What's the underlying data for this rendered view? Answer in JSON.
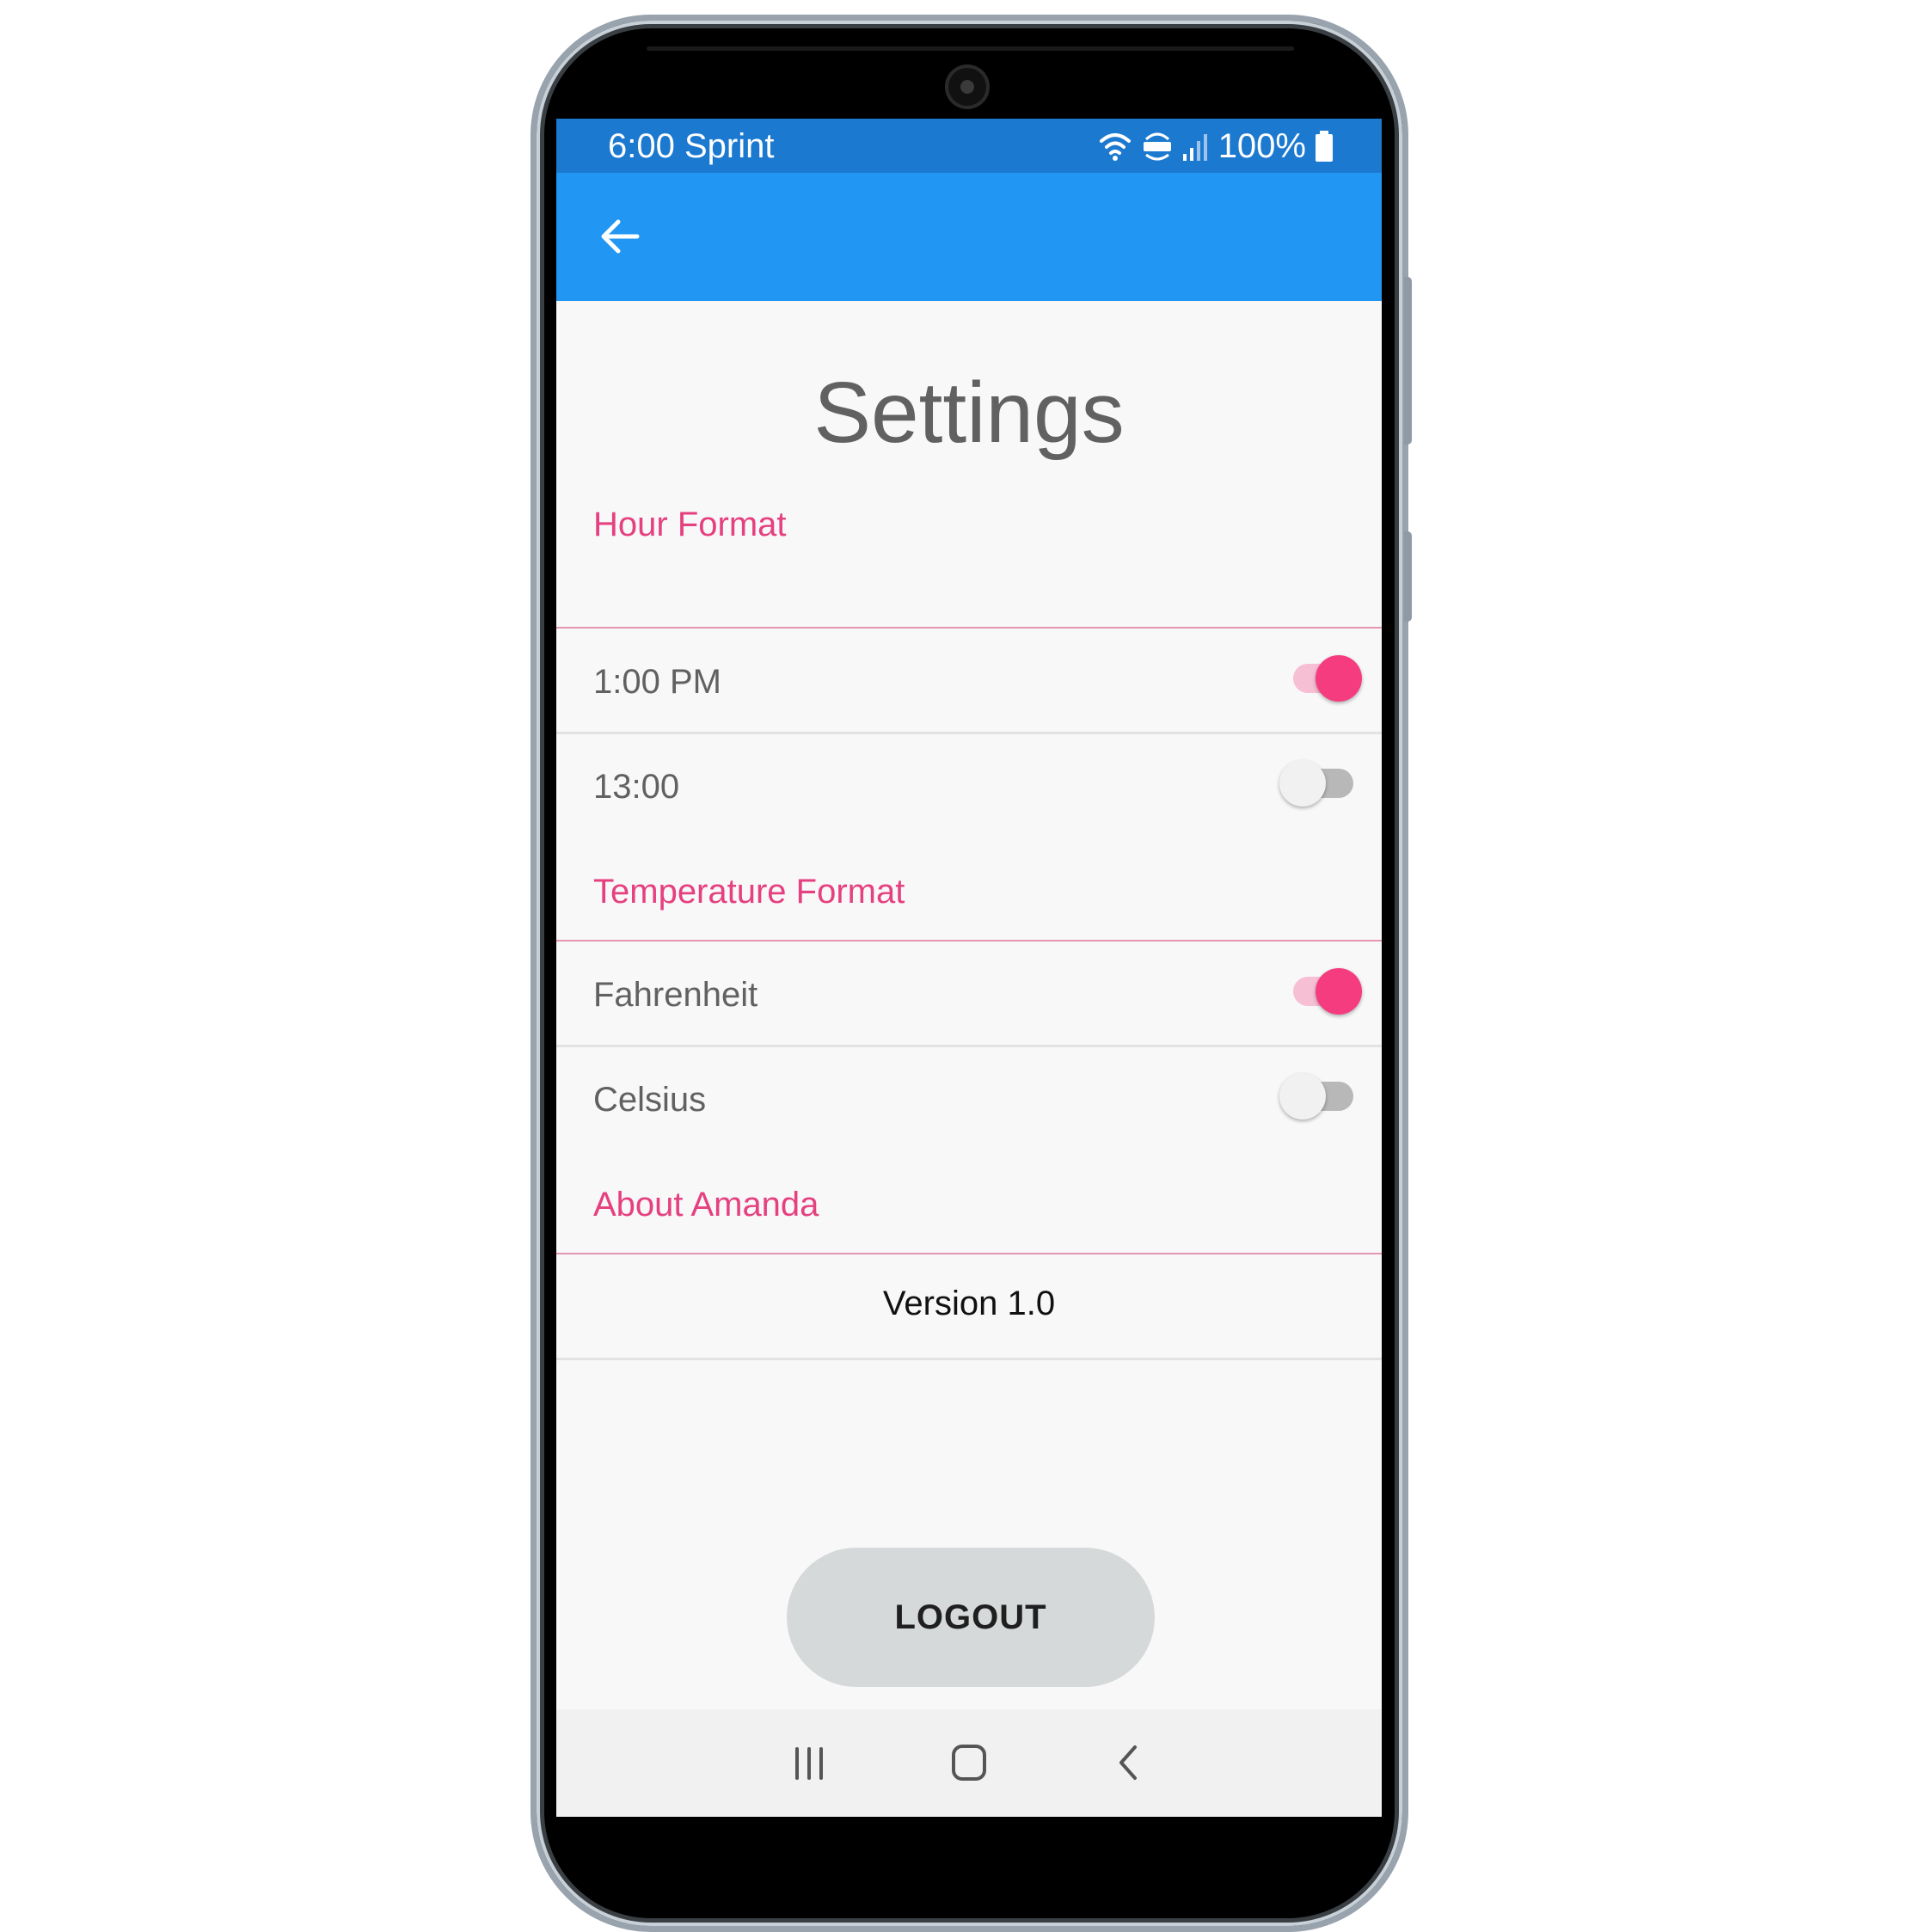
{
  "status_bar": {
    "time_carrier": "6:00 Sprint",
    "battery": "100%"
  },
  "header": {
    "title": "Settings"
  },
  "hour_format": {
    "header": "Hour Format",
    "options": [
      {
        "label": "1:00 PM",
        "enabled": true
      },
      {
        "label": "13:00",
        "enabled": false
      }
    ]
  },
  "temperature_format": {
    "header": "Temperature Format",
    "options": [
      {
        "label": "Fahrenheit",
        "enabled": true
      },
      {
        "label": "Celsius",
        "enabled": false
      }
    ]
  },
  "about": {
    "header": "About Amanda",
    "version": "Version 1.0"
  },
  "actions": {
    "logout_label": "LOGOUT"
  },
  "colors": {
    "status_bar": "#1c79d0",
    "app_bar": "#2196f3",
    "accent_pink": "#e5407f",
    "toggle_on": "#f53c7f",
    "background": "#f8f8f8",
    "logout_button": "#d6d9d9"
  },
  "icons": {
    "back": "arrow-back-icon",
    "wifi": "wifi-icon",
    "volte": "volte-icon",
    "signal": "signal-icon",
    "battery": "battery-icon",
    "nav_recents": "recents-icon",
    "nav_home": "home-icon",
    "nav_back": "chevron-left-icon"
  }
}
